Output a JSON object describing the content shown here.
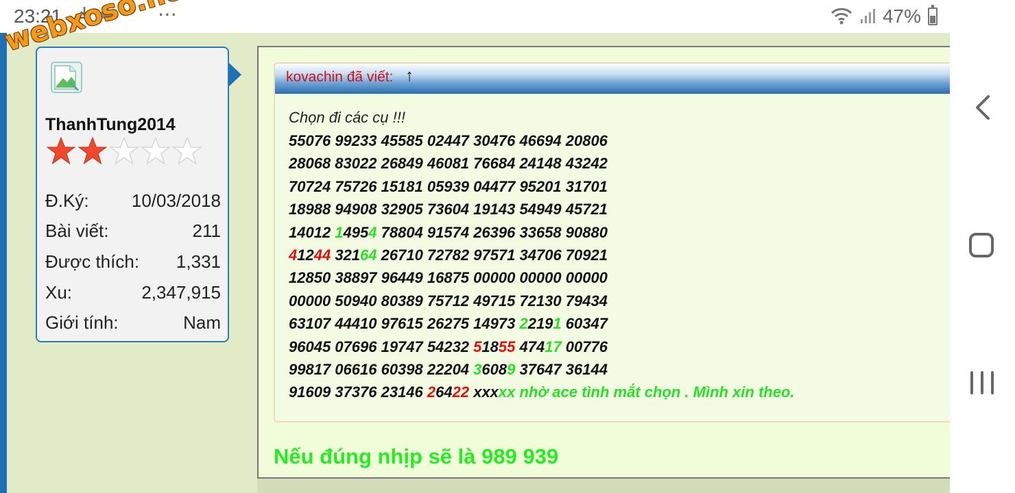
{
  "status_bar": {
    "time": "23:21",
    "dots": "⋯",
    "battery_percent": "47%"
  },
  "watermark": "webxoso.net",
  "user": {
    "username": "ThanhTung2014",
    "rating_stars": 2,
    "rating_max": 5,
    "info": [
      {
        "label": "Đ.Ký:",
        "value": "10/03/2018"
      },
      {
        "label": "Bài viết:",
        "value": "211"
      },
      {
        "label": "Được thích:",
        "value": "1,331"
      },
      {
        "label": "Xu:",
        "value": "2,347,915"
      },
      {
        "label": "Giới tính:",
        "value": "Nam"
      }
    ]
  },
  "quote": {
    "author_label": "kovachin đã viết:",
    "arrow": "↑",
    "intro": "Chọn đi các cụ !!!",
    "lines": [
      [
        {
          "t": "55076 99233 45585 02447 30476 46694 20806",
          "c": "k"
        }
      ],
      [
        {
          "t": "28068 83022 26849 46081 76684 24148 43242",
          "c": "k"
        }
      ],
      [
        {
          "t": "70724 75726 15181 05939 04477 95201 31701",
          "c": "k"
        }
      ],
      [
        {
          "t": "18988 94908 32905 73604 19143 54949 45721",
          "c": "k"
        }
      ],
      [
        {
          "t": "14012 ",
          "c": "k"
        },
        {
          "t": "1",
          "c": "g"
        },
        {
          "t": "495",
          "c": "k"
        },
        {
          "t": "4",
          "c": "g"
        },
        {
          "t": " 78804 91574 26396 33658 90880",
          "c": "k"
        }
      ],
      [
        {
          "t": "4",
          "c": "r"
        },
        {
          "t": "12",
          "c": "k"
        },
        {
          "t": "44",
          "c": "r"
        },
        {
          "t": " 321",
          "c": "k"
        },
        {
          "t": "64",
          "c": "g"
        },
        {
          "t": " 26710 72782 97571 34706 70921",
          "c": "k"
        }
      ],
      [
        {
          "t": "12850 38897 96449 16875 00000 00000 00000",
          "c": "k"
        }
      ],
      [
        {
          "t": "00000 50940 80389 75712 49715 72130 79434",
          "c": "k"
        }
      ],
      [
        {
          "t": "63107 44410 97615 26275 14973 ",
          "c": "k"
        },
        {
          "t": "2",
          "c": "g"
        },
        {
          "t": "219",
          "c": "k"
        },
        {
          "t": "1",
          "c": "g"
        },
        {
          "t": " 60347",
          "c": "k"
        }
      ],
      [
        {
          "t": "96045 07696 19747 54232 ",
          "c": "k"
        },
        {
          "t": "5",
          "c": "r"
        },
        {
          "t": "18",
          "c": "k"
        },
        {
          "t": "55",
          "c": "r"
        },
        {
          "t": " 474",
          "c": "k"
        },
        {
          "t": "17",
          "c": "g"
        },
        {
          "t": " 00776",
          "c": "k"
        }
      ],
      [
        {
          "t": "99817 06616 60398 22204 ",
          "c": "k"
        },
        {
          "t": "3",
          "c": "g"
        },
        {
          "t": "608",
          "c": "k"
        },
        {
          "t": "9",
          "c": "g"
        },
        {
          "t": " 37647 36144",
          "c": "k"
        }
      ],
      [
        {
          "t": "91609 37376 23146 ",
          "c": "k"
        },
        {
          "t": "2",
          "c": "r"
        },
        {
          "t": "64",
          "c": "k"
        },
        {
          "t": "22",
          "c": "r"
        },
        {
          "t": " xxx",
          "c": "k"
        },
        {
          "t": "xx nhờ ace tình mắt chọn . Mình xin theo.",
          "c": "g"
        }
      ]
    ]
  },
  "post_note": "Nếu đúng nhịp sẽ là 989 939",
  "colors": {
    "page_bg": "#e2ebc8",
    "post_bg": "#f1fcd9",
    "accent_blue": "#1f6fb3",
    "highlight_green": "#28e028",
    "highlight_red": "#e01010",
    "author_red": "#d0111b",
    "star_filled": "#f0482a"
  }
}
